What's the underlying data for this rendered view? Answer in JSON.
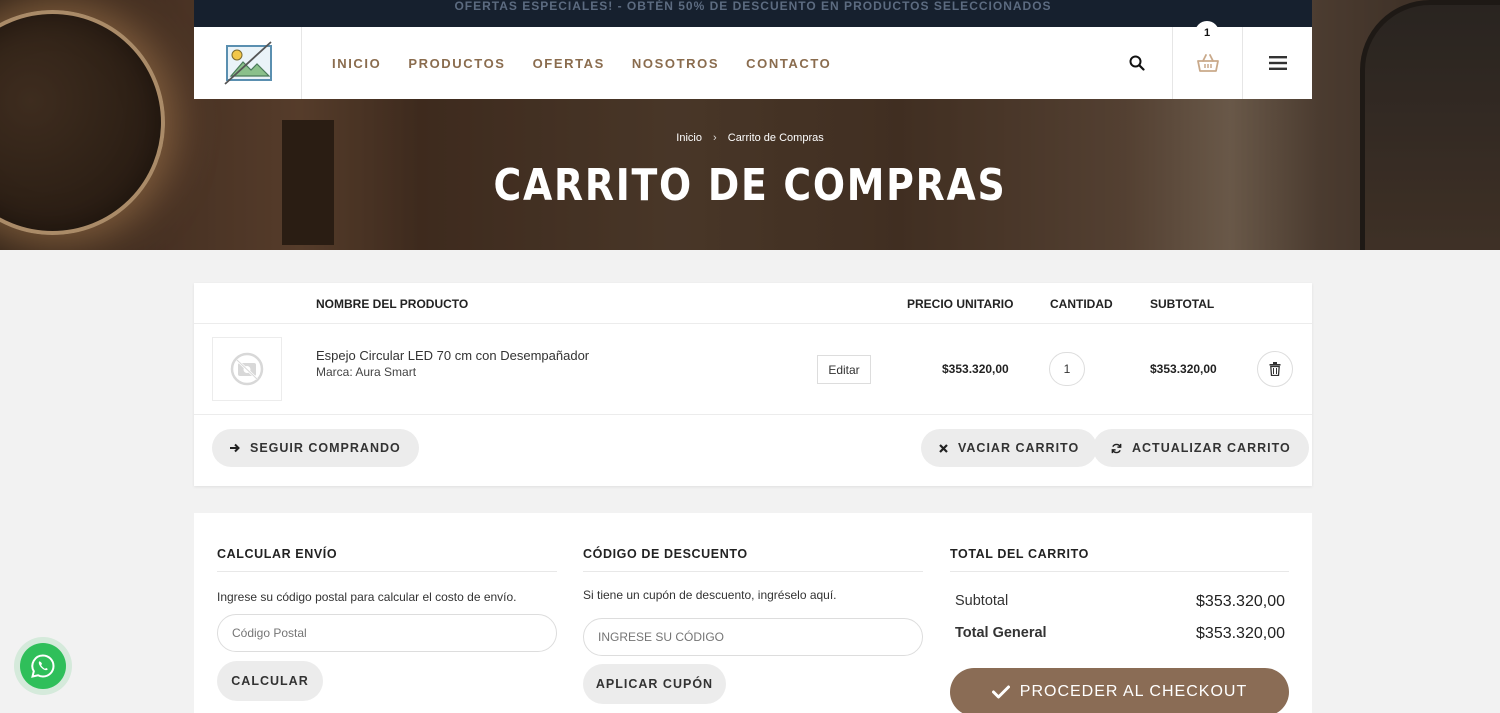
{
  "topbar": {
    "promo": "OFERTAS ESPECIALES! - OBTÉN 50% DE DESCUENTO EN PRODUCTOS SELECCIONADOS"
  },
  "nav": {
    "items": [
      "INICIO",
      "PRODUCTOS",
      "OFERTAS",
      "NOSOTROS",
      "CONTACTO"
    ],
    "cart_count": "1"
  },
  "hero": {
    "breadcrumb_home": "Inicio",
    "breadcrumb_current": "Carrito de Compras",
    "title": "CARRITO DE COMPRAS"
  },
  "cart": {
    "headers": {
      "product": "NOMBRE DEL PRODUCTO",
      "unit_price": "PRECIO UNITARIO",
      "quantity": "CANTIDAD",
      "subtotal": "SUBTOTAL"
    },
    "items": [
      {
        "name": "Espejo Circular LED 70 cm con Desempañador",
        "brand": "Marca: Aura Smart",
        "edit_label": "Editar",
        "unit_price": "$353.320,00",
        "quantity": "1",
        "subtotal": "$353.320,00"
      }
    ],
    "continue_label": "SEGUIR COMPRANDO",
    "empty_label": "VACIAR CARRITO",
    "update_label": "ACTUALIZAR CARRITO"
  },
  "shipping": {
    "title": "CALCULAR ENVÍO",
    "text": "Ingrese su código postal para calcular el costo de envío.",
    "placeholder": "Código Postal",
    "button": "CALCULAR"
  },
  "coupon": {
    "title": "CÓDIGO DE DESCUENTO",
    "text": "Si tiene un cupón de descuento, ingréselo aquí.",
    "placeholder": "INGRESE SU CÓDIGO",
    "button": "APLICAR CUPÓN"
  },
  "totals": {
    "title": "TOTAL DEL CARRITO",
    "subtotal_label": "Subtotal",
    "subtotal_value": "$353.320,00",
    "total_label": "Total General",
    "total_value": "$353.320,00",
    "checkout_label": "PROCEDER AL CHECKOUT"
  },
  "colors": {
    "brand": "#8a6c55",
    "nav_text": "#8a6c4e",
    "topbar_bg": "#16202e",
    "whatsapp": "#2fbf5a"
  }
}
